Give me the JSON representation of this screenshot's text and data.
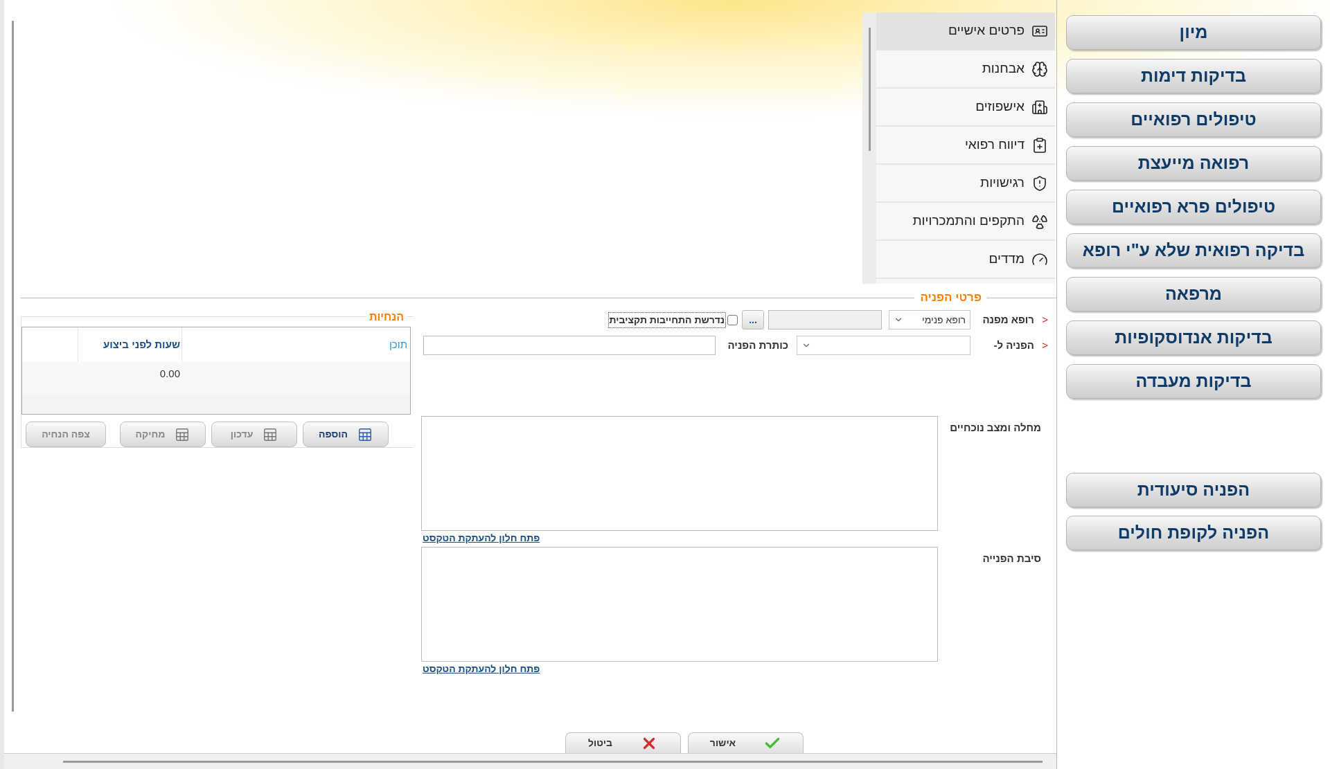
{
  "nav_items": [
    {
      "label": "פרטים אישיים",
      "kind": "personal",
      "selected": true
    },
    {
      "label": "אבחנות",
      "kind": "diagnosis",
      "selected": false
    },
    {
      "label": "אישפוזים",
      "kind": "hospital",
      "selected": false
    },
    {
      "label": "דיווח רפואי",
      "kind": "report",
      "selected": false
    },
    {
      "label": "רגישויות",
      "kind": "sensitivity",
      "selected": false
    },
    {
      "label": "התקפים והתמכרויות",
      "kind": "seizure",
      "selected": false
    },
    {
      "label": "מדדים",
      "kind": "measure",
      "selected": false
    }
  ],
  "referral_details": {
    "title": "פרטי הפניה",
    "referring_doctor": {
      "required_mark": "<",
      "label": "רופא מפנה",
      "value": "רופא פנימי"
    },
    "lookup_button": "...",
    "budget_commitment": {
      "label": "נדרשת התחייבות תקציבית",
      "checked": false
    },
    "referral_to": {
      "required_mark": "<",
      "label": "הפניה ל-"
    },
    "referral_title": {
      "label": "כותרת הפניה"
    },
    "current_condition": {
      "label": "מחלה ומצב נוכחיים",
      "link": "פתח חלון להעתקת הטקסט"
    },
    "referral_reason": {
      "label": "סיבת הפנייה",
      "link": "פתח חלון להעתקת הטקסט"
    }
  },
  "guidelines": {
    "title": "הנחיות",
    "columns": [
      "תוכן",
      "שעות לפני ביצוע"
    ],
    "rows": [
      {
        "hours_before": "0.00"
      }
    ],
    "buttons": [
      {
        "label": "הוספה",
        "kind": "add",
        "disabled": false
      },
      {
        "label": "עדכון",
        "kind": "edit",
        "disabled": true
      },
      {
        "label": "מחיקה",
        "kind": "delete",
        "disabled": true
      },
      {
        "label": "צפה הנחיה",
        "kind": "view",
        "disabled": true
      }
    ]
  },
  "dialog_buttons": [
    {
      "label": "אישור",
      "kind": "ok"
    },
    {
      "label": "ביטול",
      "kind": "cancel"
    }
  ],
  "side_buttons": [
    {
      "label": "מיון"
    },
    {
      "label": "בדיקות דימות"
    },
    {
      "label": "טיפולים רפואיים"
    },
    {
      "label": "רפואה מייעצת"
    },
    {
      "label": "טיפולים פרא רפואיים"
    },
    {
      "label": "בדיקה רפואית שלא ע\"י רופא"
    },
    {
      "label": "מרפאה"
    },
    {
      "label": "בדיקות אנדוסקופיות"
    },
    {
      "label": "בדיקות מעבדה"
    }
  ],
  "referral_buttons": [
    {
      "label": "הפניה סיעודית"
    },
    {
      "label": "הפניה לקופת חולים"
    }
  ]
}
